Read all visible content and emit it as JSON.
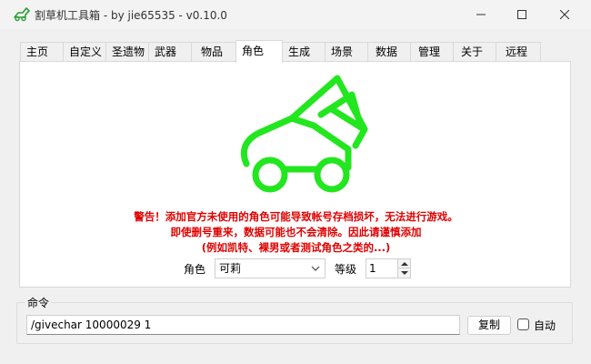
{
  "window": {
    "title": "割草机工具箱  - by jie65535  - v0.10.0"
  },
  "tabs": [
    {
      "label": "主页"
    },
    {
      "label": "自定义"
    },
    {
      "label": "圣遗物"
    },
    {
      "label": "武器"
    },
    {
      "label": "物品"
    },
    {
      "label": "角色",
      "active": true
    },
    {
      "label": "生成"
    },
    {
      "label": "场景"
    },
    {
      "label": "数据"
    },
    {
      "label": "管理"
    },
    {
      "label": "关于"
    },
    {
      "label": "远程"
    }
  ],
  "panel": {
    "icon": "lawnmower-car-icon",
    "icon_color": "#22e61e",
    "warning_color": "#e00000",
    "warnings": [
      "警告！添加官方未使用的角色可能导致帐号存档损坏，无法进行游戏。",
      "即使删号重来，数据可能也不会清除。因此请谨慎添加",
      "(例如凯特、裸男或者测试角色之类的...)"
    ],
    "role_label": "角色",
    "role_value": "可莉",
    "level_label": "等级",
    "level_value": "1"
  },
  "command": {
    "legend": "命令",
    "value": "/givechar 10000029 1",
    "copy_label": "复制",
    "auto_label": "自动"
  }
}
